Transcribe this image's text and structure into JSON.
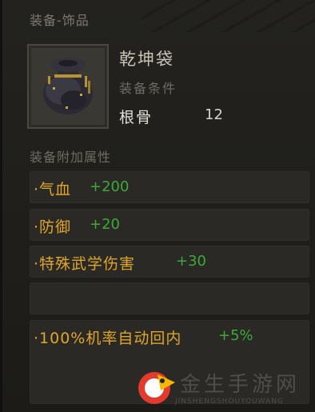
{
  "header": {
    "section_title": "装备-饰品"
  },
  "item": {
    "name": "乾坤袋",
    "requirement_label": "装备条件",
    "requirement": {
      "stat": "根骨",
      "value": "12"
    }
  },
  "attributes": {
    "title": "装备附加属性",
    "rows": [
      {
        "label": "·气血",
        "value": "+200"
      },
      {
        "label": "·防御",
        "value": "+20"
      },
      {
        "label": "·特殊武学伤害",
        "value": "+30"
      },
      {
        "label": "",
        "value": ""
      },
      {
        "label": "·100%机率自动回内",
        "value": "+5%"
      }
    ]
  },
  "watermark": {
    "cn": "金生手游网",
    "en": "JINSHENGSHOUYOUWANG"
  },
  "colors": {
    "label_orange": "#e0a628",
    "value_green": "#3fa83a",
    "background": "#1e1d19"
  }
}
